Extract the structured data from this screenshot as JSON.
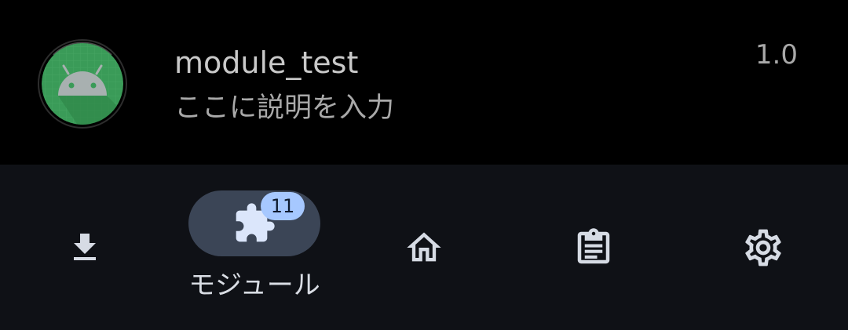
{
  "module": {
    "name": "module_test",
    "description": "ここに説明を入力",
    "version": "1.0",
    "icon": "android-icon"
  },
  "bottom_nav": {
    "items": [
      {
        "id": "install",
        "icon": "download-icon",
        "label": "",
        "selected": false
      },
      {
        "id": "modules",
        "icon": "puzzle-icon",
        "label": "モジュール",
        "badge": "11",
        "selected": true
      },
      {
        "id": "home",
        "icon": "home-icon",
        "label": "",
        "selected": false
      },
      {
        "id": "logs",
        "icon": "clipboard-icon",
        "label": "",
        "selected": false
      },
      {
        "id": "settings",
        "icon": "gear-icon",
        "label": "",
        "selected": false
      }
    ]
  },
  "colors": {
    "background": "#000000",
    "nav_background": "#0f1116",
    "pill": "#3b4556",
    "badge": "#a6c8ff",
    "android_green": "#3a9b58",
    "icon": "#d6dbe4"
  }
}
